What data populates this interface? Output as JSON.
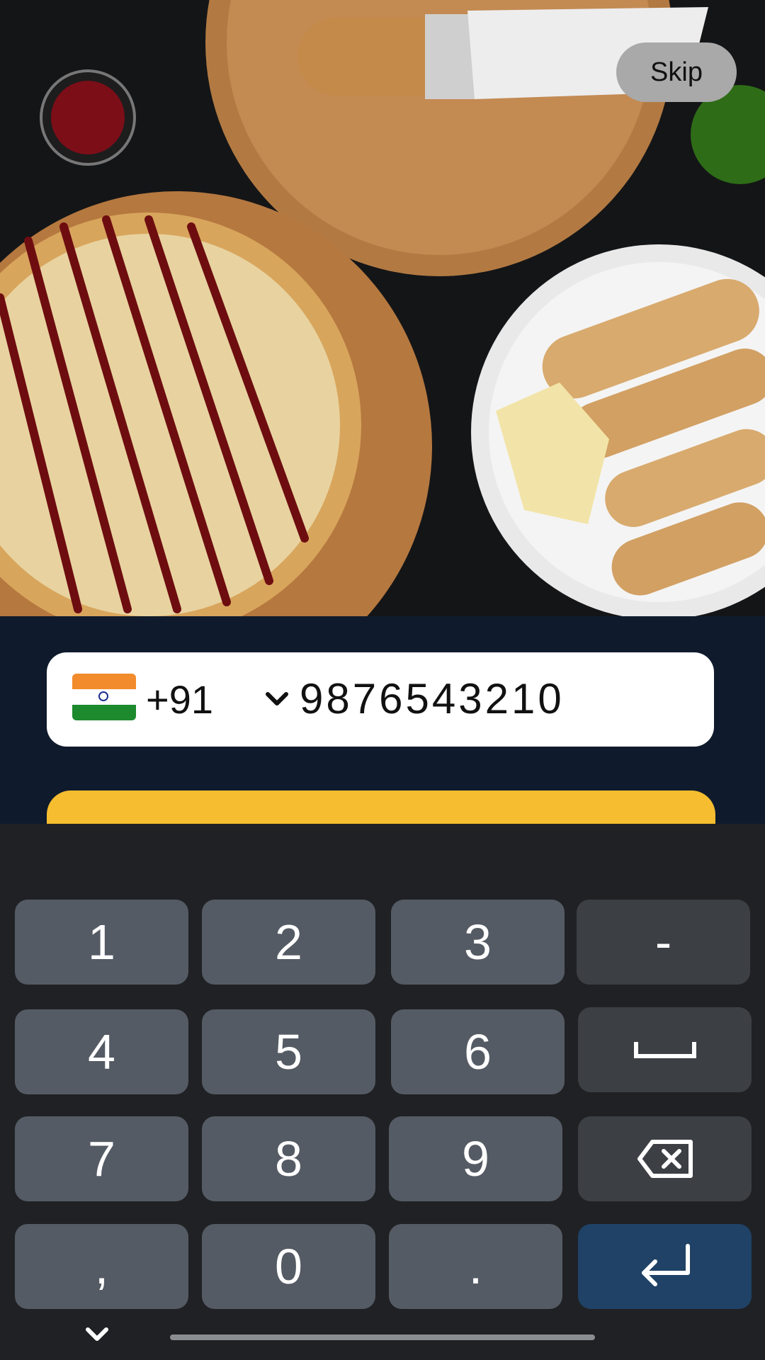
{
  "hero": {
    "skip_label": "Skip"
  },
  "login": {
    "country_code": "+91",
    "phone_number": "9876543210"
  },
  "keyboard": {
    "keys": [
      "1",
      "2",
      "3",
      "-",
      "4",
      "5",
      "6",
      "7",
      "8",
      "9",
      ",",
      "0",
      "."
    ]
  },
  "icons": [
    "india-flag-icon",
    "chevron-down-icon",
    "space-icon",
    "backspace-icon",
    "enter-icon",
    "keyboard-hide-icon"
  ],
  "colors": {
    "accent": "#f5bd2f",
    "form_background": "#0f1b2c",
    "enter_key": "#1f4266"
  }
}
